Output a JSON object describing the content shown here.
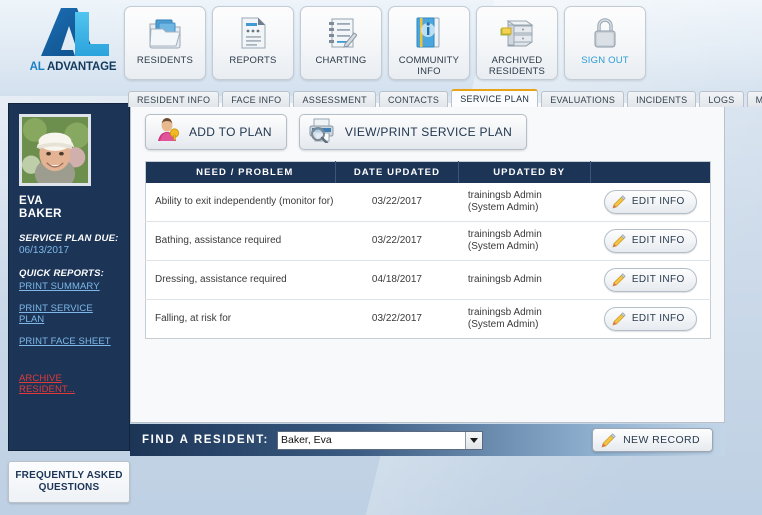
{
  "brand": {
    "logo_icon": "al-advantage-logo",
    "name_part1": "AL",
    "name_part2": "ADVANTAGE"
  },
  "header": {
    "nav_buttons": [
      {
        "label": "RESIDENTS",
        "icon": "folder-files-icon"
      },
      {
        "label": "REPORTS",
        "icon": "document-report-icon"
      },
      {
        "label": "CHARTING",
        "icon": "clipboard-pen-icon"
      },
      {
        "label": "COMMUNITY\nINFO",
        "icon": "info-book-icon"
      },
      {
        "label": "ARCHIVED\nRESIDENTS",
        "icon": "file-cabinet-icon"
      },
      {
        "label": "SIGN OUT",
        "icon": "padlock-icon"
      }
    ],
    "nav_labels": {
      "residents": "RESIDENTS",
      "reports": "REPORTS",
      "charting": "CHARTING",
      "community_info_l1": "COMMUNITY",
      "community_info_l2": "INFO",
      "archived_l1": "ARCHIVED",
      "archived_l2": "RESIDENTS",
      "sign_out": "SIGN OUT"
    }
  },
  "tabs": [
    {
      "label": "RESIDENT INFO",
      "active": false
    },
    {
      "label": "FACE INFO",
      "active": false
    },
    {
      "label": "ASSESSMENT",
      "active": false
    },
    {
      "label": "CONTACTS",
      "active": false
    },
    {
      "label": "SERVICE PLAN",
      "active": true
    },
    {
      "label": "EVALUATIONS",
      "active": false
    },
    {
      "label": "INCIDENTS",
      "active": false
    },
    {
      "label": "LOGS",
      "active": false
    },
    {
      "label": "MEDS",
      "active": false
    }
  ],
  "sidebar": {
    "photo_alt": "resident-photo-elderly-woman-white-cap",
    "first_name": "EVA",
    "last_name": "BAKER",
    "service_plan_due_label": "SERVICE PLAN DUE:",
    "service_plan_due_value": "06/13/2017",
    "quick_reports_label": "QUICK REPORTS:",
    "links": [
      "PRINT SUMMARY",
      "PRINT SERVICE PLAN",
      "PRINT FACE SHEET"
    ],
    "archive_link": "ARCHIVE RESIDENT...",
    "faq_line1": "FREQUENTLY ASKED",
    "faq_line2": "QUESTIONS"
  },
  "main": {
    "add_to_plan_label": "ADD TO PLAN",
    "view_print_label": "VIEW/PRINT SERVICE PLAN",
    "table": {
      "columns": [
        "NEED / PROBLEM",
        "DATE UPDATED",
        "UPDATED BY",
        ""
      ],
      "edit_label": "EDIT INFO",
      "rows": [
        {
          "need": "Ability to exit independently (monitor for)",
          "date_updated": "03/22/2017",
          "updated_by_line1": "trainingsb Admin",
          "updated_by_line2": "(System Admin)"
        },
        {
          "need": "Bathing, assistance required",
          "date_updated": "03/22/2017",
          "updated_by_line1": "trainingsb Admin",
          "updated_by_line2": "(System Admin)"
        },
        {
          "need": "Dressing, assistance required",
          "date_updated": "04/18/2017",
          "updated_by_line1": "trainingsb Admin",
          "updated_by_line2": ""
        },
        {
          "need": "Falling, at risk for",
          "date_updated": "03/22/2017",
          "updated_by_line1": "trainingsb Admin",
          "updated_by_line2": "(System Admin)"
        }
      ]
    }
  },
  "find_bar": {
    "label": "FIND A RESIDENT:",
    "selected_resident": "Baker, Eva",
    "new_record_label": "NEW RECORD"
  },
  "colors": {
    "navy": "#1c3557",
    "accent_orange": "#e8a317",
    "link_blue": "#7fb8e8",
    "danger_red": "#e03a3a",
    "page_blue": "#cfdceb"
  }
}
